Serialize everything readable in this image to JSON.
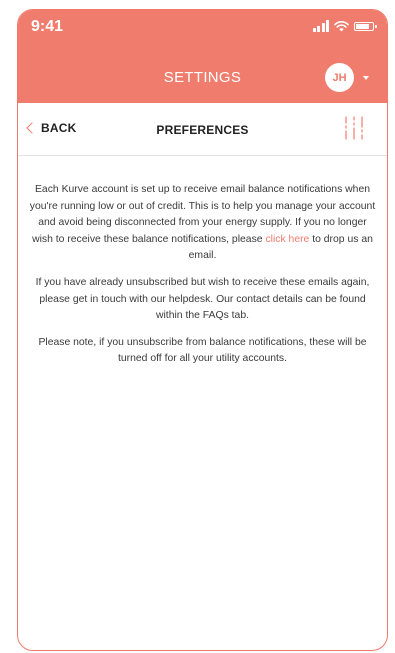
{
  "status_bar": {
    "time": "9:41",
    "icons": [
      "signal-icon",
      "wifi-icon",
      "battery-icon"
    ]
  },
  "header": {
    "title": "SETTINGS",
    "user_initials": "JH",
    "accent_color": "#ef7c6d"
  },
  "subheader": {
    "back_label": "BACK",
    "title": "PREFERENCES",
    "filter_icon": "sliders-icon"
  },
  "content": {
    "p1_before": "Each Kurve account is set up to receive email balance notifications when you're running low or out of credit. This is to help you manage your account and avoid being disconnected from your energy supply. If you no longer wish to receive these balance notifications, please ",
    "p1_link": "click here",
    "p1_after": " to drop us an email.",
    "p2": "If you have already unsubscribed but wish to receive these emails again, please get in touch with our helpdesk. Our contact details can be found within the FAQs tab.",
    "p3": "Please note, if you unsubscribe from balance notifications, these will be turned off for all your utility accounts."
  }
}
